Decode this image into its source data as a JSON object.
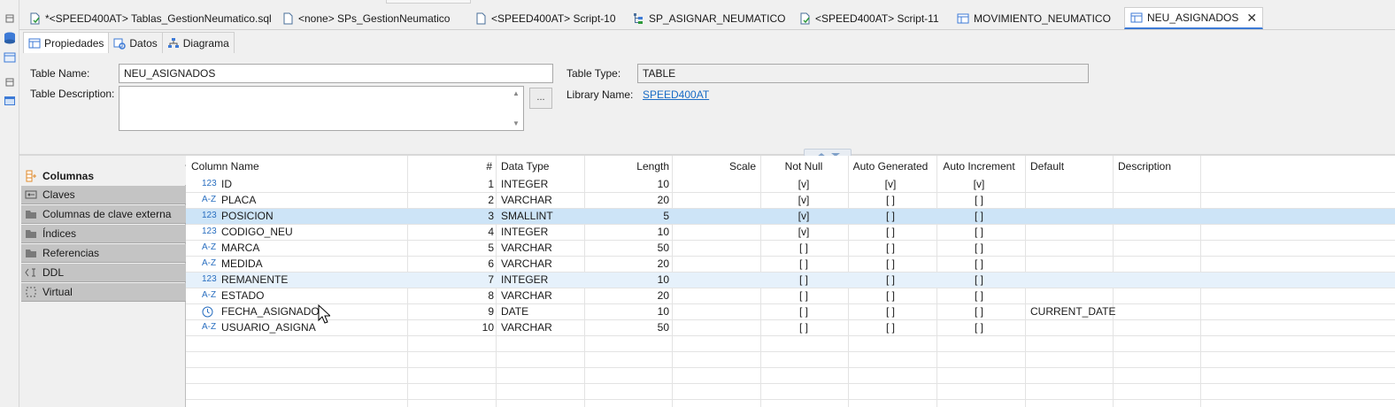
{
  "editor_tabs": [
    {
      "label": "*<SPEED400AT> Tablas_GestionNeumatico.sql",
      "icon": "sql-script-icon"
    },
    {
      "label": "<none> SPs_GestionNeumatico",
      "icon": "sql-script-icon"
    },
    {
      "label": "<SPEED400AT> Script-10",
      "icon": "sql-script-icon"
    },
    {
      "label": "SP_ASIGNAR_NEUMATICO",
      "icon": "procedure-icon"
    },
    {
      "label": "<SPEED400AT> Script-11",
      "icon": "sql-script-icon"
    },
    {
      "label": "MOVIMIENTO_NEUMATICO",
      "icon": "table-icon"
    },
    {
      "label": "NEU_ASIGNADOS",
      "icon": "table-icon",
      "close": "✕"
    }
  ],
  "sub_tabs": [
    {
      "label": "Propiedades",
      "icon": "properties-icon"
    },
    {
      "label": "Datos",
      "icon": "data-icon"
    },
    {
      "label": "Diagrama",
      "icon": "diagram-icon"
    }
  ],
  "form": {
    "table_name_label": "Table Name:",
    "table_name_value": "NEU_ASIGNADOS",
    "table_description_label": "Table Description:",
    "table_description_value": "",
    "dots_button": "...",
    "table_type_label": "Table Type:",
    "table_type_value": "TABLE",
    "library_name_label": "Library Name:",
    "library_name_value": "SPEED400AT"
  },
  "side_panel": [
    {
      "label": "Columnas",
      "icon": "columns-icon"
    },
    {
      "label": "Claves",
      "icon": "keys-icon"
    },
    {
      "label": "Columnas de clave externa",
      "icon": "folder-icon"
    },
    {
      "label": "Índices",
      "icon": "folder-icon"
    },
    {
      "label": "Referencias",
      "icon": "folder-icon"
    },
    {
      "label": "DDL",
      "icon": "ddl-icon"
    },
    {
      "label": "Virtual",
      "icon": "virtual-icon"
    }
  ],
  "grid": {
    "headers": [
      "Column Name",
      "#",
      "Data Type",
      "Length",
      "Scale",
      "Not Null",
      "Auto Generated",
      "Auto Increment",
      "Default",
      "Description"
    ],
    "rows": [
      {
        "type_icon": "123",
        "name": "ID",
        "num": "1",
        "data_type": "INTEGER",
        "length": "10",
        "scale": "",
        "not_null": "[v]",
        "auto_gen": "[v]",
        "auto_inc": "[v]",
        "default": "",
        "description": ""
      },
      {
        "type_icon": "A-Z",
        "name": "PLACA",
        "num": "2",
        "data_type": "VARCHAR",
        "length": "20",
        "scale": "",
        "not_null": "[v]",
        "auto_gen": "[ ]",
        "auto_inc": "[ ]",
        "default": "",
        "description": ""
      },
      {
        "type_icon": "123",
        "name": "POSICION",
        "num": "3",
        "data_type": "SMALLINT",
        "length": "5",
        "scale": "",
        "not_null": "[v]",
        "auto_gen": "[ ]",
        "auto_inc": "[ ]",
        "default": "",
        "description": ""
      },
      {
        "type_icon": "123",
        "name": "CODIGO_NEU",
        "num": "4",
        "data_type": "INTEGER",
        "length": "10",
        "scale": "",
        "not_null": "[v]",
        "auto_gen": "[ ]",
        "auto_inc": "[ ]",
        "default": "",
        "description": ""
      },
      {
        "type_icon": "A-Z",
        "name": "MARCA",
        "num": "5",
        "data_type": "VARCHAR",
        "length": "50",
        "scale": "",
        "not_null": "[ ]",
        "auto_gen": "[ ]",
        "auto_inc": "[ ]",
        "default": "",
        "description": ""
      },
      {
        "type_icon": "A-Z",
        "name": "MEDIDA",
        "num": "6",
        "data_type": "VARCHAR",
        "length": "20",
        "scale": "",
        "not_null": "[ ]",
        "auto_gen": "[ ]",
        "auto_inc": "[ ]",
        "default": "",
        "description": ""
      },
      {
        "type_icon": "123",
        "name": "REMANENTE",
        "num": "7",
        "data_type": "INTEGER",
        "length": "10",
        "scale": "",
        "not_null": "[ ]",
        "auto_gen": "[ ]",
        "auto_inc": "[ ]",
        "default": "",
        "description": ""
      },
      {
        "type_icon": "A-Z",
        "name": "ESTADO",
        "num": "8",
        "data_type": "VARCHAR",
        "length": "20",
        "scale": "",
        "not_null": "[ ]",
        "auto_gen": "[ ]",
        "auto_inc": "[ ]",
        "default": "",
        "description": ""
      },
      {
        "type_icon": "clock",
        "name": "FECHA_ASIGNADO",
        "num": "9",
        "data_type": "DATE",
        "length": "10",
        "scale": "",
        "not_null": "[ ]",
        "auto_gen": "[ ]",
        "auto_inc": "[ ]",
        "default": "CURRENT_DATE",
        "description": ""
      },
      {
        "type_icon": "A-Z",
        "name": "USUARIO_ASIGNA",
        "num": "10",
        "data_type": "VARCHAR",
        "length": "50",
        "scale": "",
        "not_null": "[ ]",
        "auto_gen": "[ ]",
        "auto_inc": "[ ]",
        "default": "",
        "description": ""
      }
    ]
  },
  "colors": {
    "accent": "#3d7ad6",
    "selected_row": "#cde4f7",
    "hover_row": "#e6f1fb",
    "link": "#1a6cc6"
  }
}
